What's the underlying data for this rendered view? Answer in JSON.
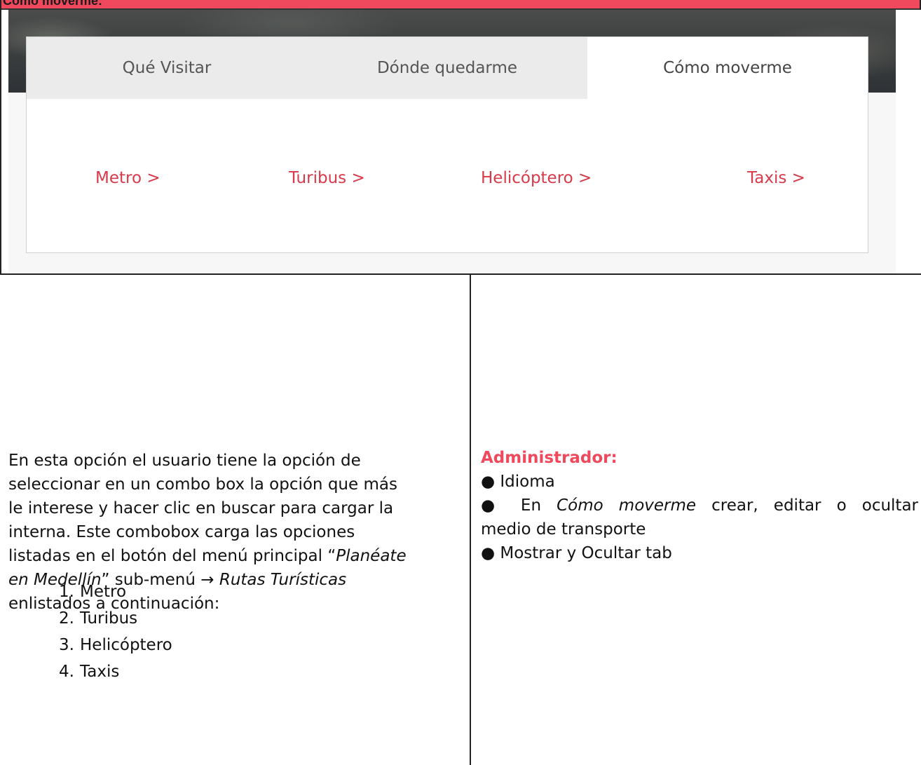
{
  "header": {
    "text": "Cómo moverme:"
  },
  "tabs": [
    {
      "label": "Qué Visitar"
    },
    {
      "label": "Dónde quedarme"
    },
    {
      "label": "Cómo moverme"
    }
  ],
  "transport_links": [
    {
      "label": "Metro >"
    },
    {
      "label": "Turibus >"
    },
    {
      "label": "Helicóptero >"
    },
    {
      "label": "Taxis >"
    }
  ],
  "description": {
    "line1": "En esta opción el usuario tiene la opción de",
    "line2": "seleccionar en un combo box la opción que más",
    "line3": "le interese y hacer clic en buscar para cargar la",
    "line4": "interna. Este combobox carga las  opciones",
    "line5_a": "listadas en el botón del menú principal “",
    "line5_b": "Planéate",
    "line6_a": "en Medellín",
    "line6_b": "” sub-menú ",
    "arrow": "→",
    "line6_c": " Rutas Turísticas",
    "line7": "enlistados a continuación:"
  },
  "list": [
    {
      "num": "1.",
      "label": "Metro"
    },
    {
      "num": "2.",
      "label": "Turibus"
    },
    {
      "num": "3.",
      "label": "Helicóptero"
    },
    {
      "num": "4.",
      "label": "Taxis"
    }
  ],
  "admin": {
    "title": "Administrador:",
    "bullet": "●",
    "item1": " Idioma",
    "item2_a": " En ",
    "item2_b": "Cómo moverme",
    "item2_c": " crear, editar o ocultar",
    "item2_d": "medio de transporte",
    "item3": " Mostrar y Ocultar tab"
  }
}
